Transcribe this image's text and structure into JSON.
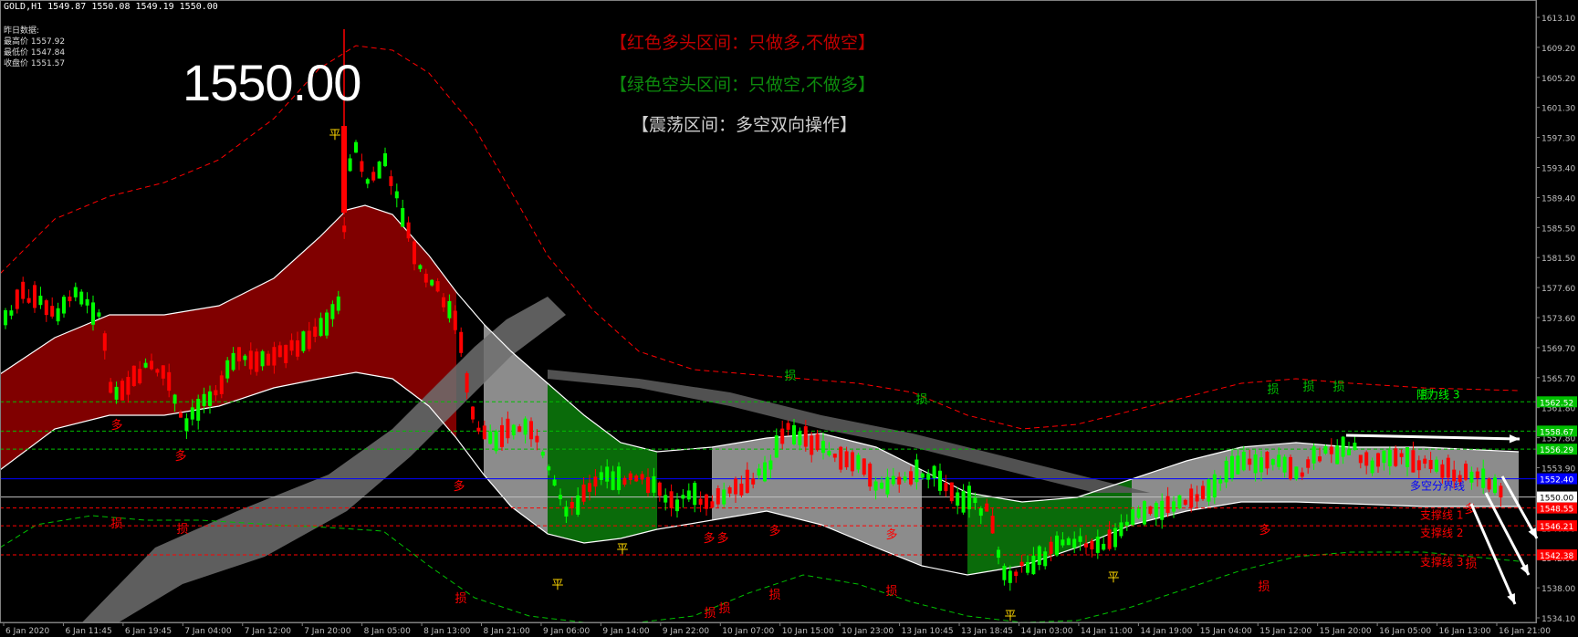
{
  "header": {
    "symbol_line": "GOLD,H1  1549.87 1550.08 1549.19 1550.00"
  },
  "info": {
    "title": "昨日数据:",
    "high": "最高价 1557.92",
    "low": "最低价 1547.84",
    "close": "收盘价 1551.57"
  },
  "current_price": "1550.00",
  "zones": {
    "bull": "【红色多头区间：只做多,不做空】",
    "bear": "【绿色空头区间：只做空,不做多】",
    "range": "【震荡区间：多空双向操作】"
  },
  "colors": {
    "background": "#000000",
    "bull_candle": "#00ff00",
    "bear_candle": "#ff0000",
    "bull_zone": "#800000",
    "bear_zone": "#0a6b0a",
    "range_zone": "#8c8c8c",
    "divider_line": "#0000ff",
    "resistance_line": "#00ff00",
    "support_line": "#ff0000"
  },
  "lines": {
    "resistance_3": "阻力线 3",
    "divider": "多空分界线",
    "support_1": "支撑线 1",
    "support_2": "支撑线 2",
    "support_3": "支撑线 3"
  },
  "price_scale": [
    "1613.10",
    "1609.20",
    "1605.20",
    "1601.30",
    "1597.30",
    "1593.40",
    "1589.40",
    "1585.50",
    "1581.50",
    "1577.60",
    "1573.60",
    "1569.70",
    "1565.70",
    "1561.80",
    "1557.80",
    "1553.90",
    "1549.90",
    "1546.00",
    "1542.00",
    "1538.00",
    "1534.10"
  ],
  "price_boxes": [
    {
      "label": "1562.52",
      "value": 1562.52,
      "color": "#00c000",
      "text": "#fff"
    },
    {
      "label": "1558.67",
      "value": 1558.67,
      "color": "#00c000",
      "text": "#fff"
    },
    {
      "label": "1556.29",
      "value": 1556.29,
      "color": "#00c000",
      "text": "#fff"
    },
    {
      "label": "1552.40",
      "value": 1552.4,
      "color": "#0000ff",
      "text": "#fff"
    },
    {
      "label": "1550.00",
      "value": 1550.0,
      "color": "#ffffff",
      "text": "#000"
    },
    {
      "label": "1548.55",
      "value": 1548.55,
      "color": "#ff0000",
      "text": "#fff"
    },
    {
      "label": "1546.21",
      "value": 1546.21,
      "color": "#ff0000",
      "text": "#fff"
    },
    {
      "label": "1542.38",
      "value": 1542.38,
      "color": "#ff0000",
      "text": "#fff"
    }
  ],
  "time_scale": [
    "6 Jan 2020",
    "6 Jan 11:45",
    "6 Jan 19:45",
    "7 Jan 04:00",
    "7 Jan 12:00",
    "7 Jan 20:00",
    "8 Jan 05:00",
    "8 Jan 13:00",
    "8 Jan 21:00",
    "9 Jan 06:00",
    "9 Jan 14:00",
    "9 Jan 22:00",
    "10 Jan 07:00",
    "10 Jan 15:00",
    "10 Jan 23:00",
    "13 Jan 10:45",
    "13 Jan 18:45",
    "14 Jan 03:00",
    "14 Jan 11:00",
    "14 Jan 19:00",
    "15 Jan 04:00",
    "15 Jan 12:00",
    "15 Jan 20:00",
    "16 Jan 05:00",
    "16 Jan 13:00",
    "16 Jan 21:00"
  ],
  "markers": {
    "long": "多",
    "stop": "损",
    "flat": "平"
  },
  "chart_data": {
    "type": "candlestick",
    "symbol": "GOLD",
    "timeframe": "H1",
    "ylim": [
      1532.5,
      1615.0
    ],
    "horizontal_levels": [
      {
        "name": "阻力线 3",
        "value": 1562.52,
        "style": "green-dashed"
      },
      {
        "name": "",
        "value": 1558.67,
        "style": "green-dashed"
      },
      {
        "name": "",
        "value": 1556.29,
        "style": "green-dashed"
      },
      {
        "name": "多空分界线",
        "value": 1552.4,
        "style": "blue-solid"
      },
      {
        "name": "",
        "value": 1550.0,
        "style": "white-solid"
      },
      {
        "name": "支撑线 1",
        "value": 1548.55,
        "style": "red-dashed"
      },
      {
        "name": "支撑线 2",
        "value": 1546.21,
        "style": "red-dashed"
      },
      {
        "name": "支撑线 3",
        "value": 1542.38,
        "style": "red-dashed"
      }
    ],
    "last": {
      "open": 1549.87,
      "high": 1550.08,
      "low": 1549.19,
      "close": 1550.0
    }
  }
}
